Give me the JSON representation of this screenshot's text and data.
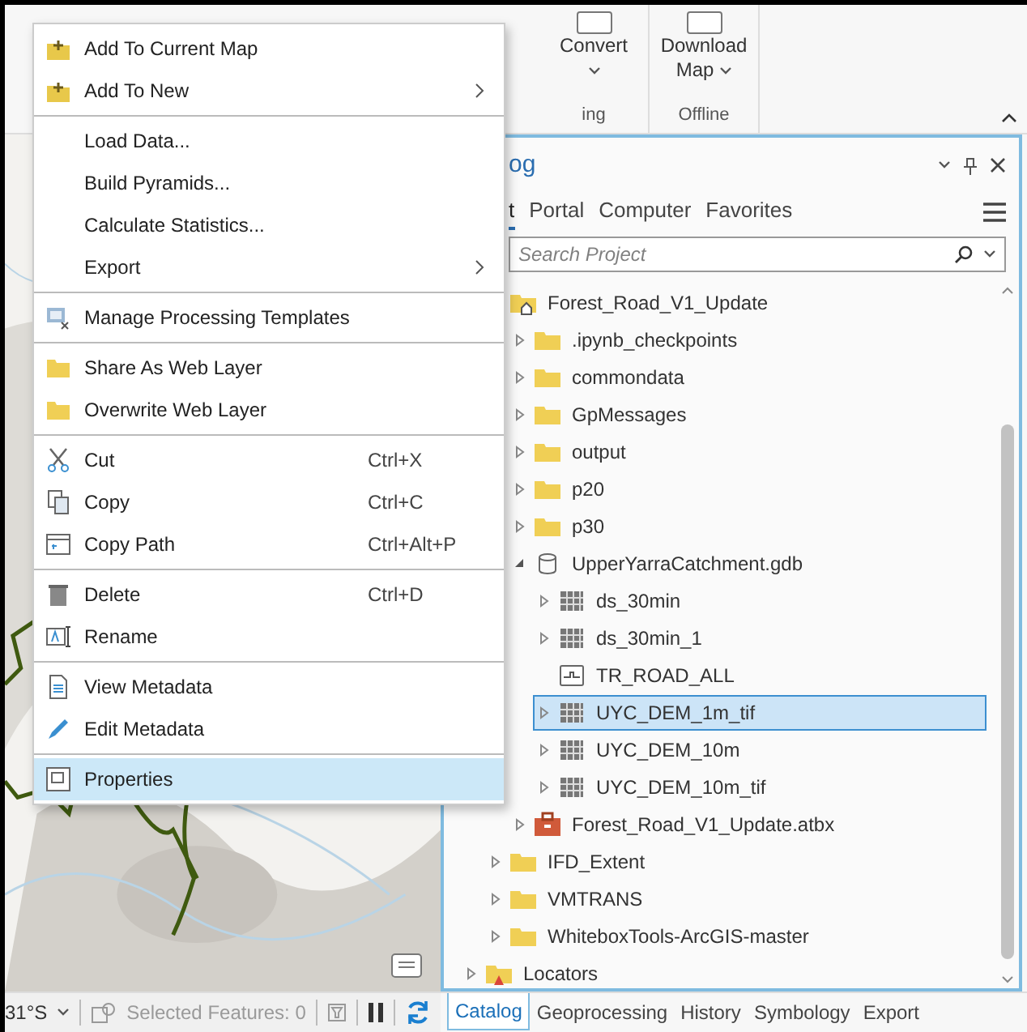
{
  "ribbon": {
    "groups": [
      {
        "label": "ing",
        "buttons": [
          {
            "label": "Convert",
            "dropdown": true
          }
        ]
      },
      {
        "label": "Offline",
        "buttons": [
          {
            "label": "Download",
            "sublabel": "Map",
            "dropdown": true
          }
        ]
      }
    ]
  },
  "catalog": {
    "title": "og",
    "tabs": [
      {
        "label": "t",
        "selected": true
      },
      {
        "label": "Portal",
        "selected": false
      },
      {
        "label": "Computer",
        "selected": false
      },
      {
        "label": "Favorites",
        "selected": false
      }
    ],
    "search": {
      "placeholder": "Search Project"
    },
    "folder_items": [
      {
        "label": "Forest_Road_V1_Update",
        "kind": "home-folder",
        "selected": false,
        "children": [
          {
            "label": ".ipynb_checkpoints",
            "kind": "folder",
            "expanded": false,
            "selected": false
          },
          {
            "label": "commondata",
            "kind": "folder",
            "expanded": false,
            "selected": false
          },
          {
            "label": "GpMessages",
            "kind": "folder",
            "expanded": false,
            "selected": false
          },
          {
            "label": "output",
            "kind": "folder",
            "expanded": false,
            "selected": false
          },
          {
            "label": "p20",
            "kind": "folder",
            "expanded": false,
            "selected": false
          },
          {
            "label": "p30",
            "kind": "folder",
            "expanded": false,
            "selected": false
          },
          {
            "label": "UpperYarraCatchment.gdb",
            "kind": "geodatabase",
            "expanded": true,
            "selected": false,
            "children": [
              {
                "label": "ds_30min",
                "kind": "raster",
                "expanded": false,
                "selected": false
              },
              {
                "label": "ds_30min_1",
                "kind": "raster",
                "expanded": false,
                "selected": false
              },
              {
                "label": "TR_ROAD_ALL",
                "kind": "polyline",
                "selected": false
              },
              {
                "label": "UYC_DEM_1m_tif",
                "kind": "raster",
                "expanded": false,
                "selected": true
              },
              {
                "label": "UYC_DEM_10m",
                "kind": "raster",
                "expanded": false,
                "selected": false
              },
              {
                "label": "UYC_DEM_10m_tif",
                "kind": "raster",
                "expanded": false,
                "selected": false
              }
            ]
          },
          {
            "label": "Forest_Road_V1_Update.atbx",
            "kind": "toolbox",
            "expanded": false,
            "selected": false
          }
        ]
      },
      {
        "label": "IFD_Extent",
        "kind": "folder",
        "expanded": false,
        "selected": false
      },
      {
        "label": "VMTRANS",
        "kind": "folder",
        "expanded": false,
        "selected": false
      },
      {
        "label": "WhiteboxTools-ArcGIS-master",
        "kind": "folder",
        "expanded": false,
        "selected": false
      }
    ],
    "root_items": [
      {
        "label": "Locators",
        "kind": "locators",
        "expanded": false,
        "selected": false
      }
    ],
    "bottom_tabs": [
      {
        "label": "Catalog",
        "selected": true
      },
      {
        "label": "Geoprocessing",
        "selected": false
      },
      {
        "label": "History",
        "selected": false
      },
      {
        "label": "Symbology",
        "selected": false
      },
      {
        "label": "Export",
        "selected": false
      }
    ]
  },
  "status_bar": {
    "coordinates": "31°S",
    "selection": "Selected Features: 0"
  },
  "context_menu": {
    "groups": [
      [
        {
          "label": "Add To Current Map",
          "selected": false
        },
        {
          "label": "Add To New",
          "submenu": true,
          "selected": false
        }
      ],
      [
        {
          "label": "Load Data...",
          "selected": false
        },
        {
          "label": "Build Pyramids...",
          "selected": false
        },
        {
          "label": "Calculate Statistics...",
          "selected": false
        },
        {
          "label": "Export",
          "submenu": true,
          "selected": false
        }
      ],
      [
        {
          "label": "Manage Processing Templates",
          "selected": false
        }
      ],
      [
        {
          "label": "Share As Web Layer",
          "selected": false
        },
        {
          "label": "Overwrite Web Layer",
          "selected": false
        }
      ],
      [
        {
          "label": "Cut",
          "shortcut": "Ctrl+X",
          "selected": false
        },
        {
          "label": "Copy",
          "shortcut": "Ctrl+C",
          "selected": false
        },
        {
          "label": "Copy Path",
          "shortcut": "Ctrl+Alt+P",
          "selected": false
        }
      ],
      [
        {
          "label": "Delete",
          "shortcut": "Ctrl+D",
          "selected": false
        },
        {
          "label": "Rename",
          "selected": false
        }
      ],
      [
        {
          "label": "View Metadata",
          "selected": false
        },
        {
          "label": "Edit Metadata",
          "selected": false
        }
      ],
      [
        {
          "label": "Properties",
          "selected": true
        }
      ]
    ]
  }
}
